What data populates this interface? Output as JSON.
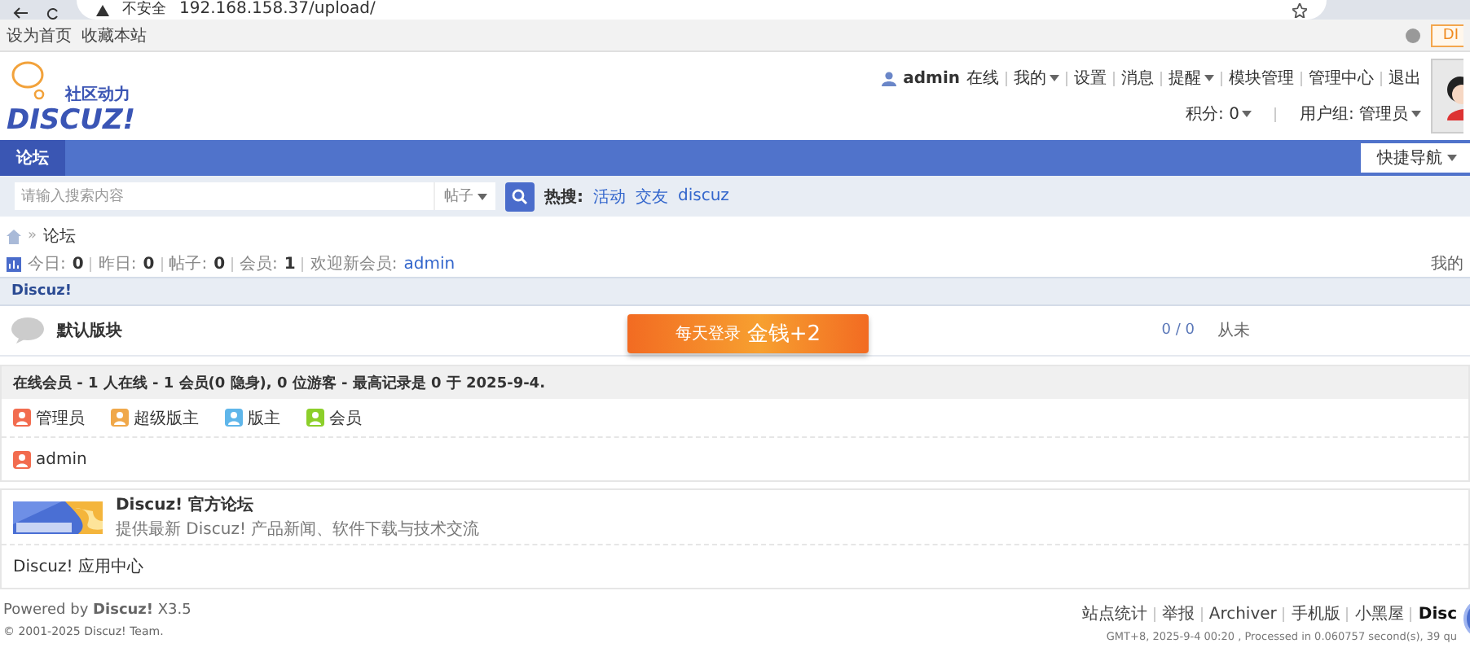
{
  "browser": {
    "security": "不安全",
    "url": "192.168.158.37/upload/"
  },
  "topbar": {
    "links": [
      "设为首页",
      "收藏本站"
    ],
    "diy": "DI"
  },
  "header": {
    "logo_tagline": "社区动力",
    "logo_text": "DISCUZ!",
    "user": "admin",
    "status": "在线",
    "links": [
      {
        "label": "我的",
        "dropdown": true
      },
      {
        "label": "设置",
        "dropdown": false
      },
      {
        "label": "消息",
        "dropdown": false
      },
      {
        "label": "提醒",
        "dropdown": true
      },
      {
        "label": "模块管理",
        "dropdown": false
      },
      {
        "label": "管理中心",
        "dropdown": false
      },
      {
        "label": "退出",
        "dropdown": false
      }
    ],
    "meta": [
      {
        "label": "积分: 0",
        "dropdown": true
      },
      {
        "label": "用户组: 管理员",
        "dropdown": true
      }
    ]
  },
  "nav": {
    "tabs": [
      {
        "label": "论坛",
        "selected": true
      }
    ],
    "quick": "快捷导航"
  },
  "search": {
    "placeholder": "请输入搜索内容",
    "type": "帖子",
    "hot_label": "热搜:",
    "hot": [
      "活动",
      "交友",
      "discuz"
    ]
  },
  "breadcrumb": {
    "separator": "»",
    "items": [
      "论坛"
    ]
  },
  "stats": [
    {
      "label": "今日:",
      "value": "0",
      "kind": "number"
    },
    {
      "label": "昨日:",
      "value": "0",
      "kind": "number"
    },
    {
      "label": "帖子:",
      "value": "0",
      "kind": "number"
    },
    {
      "label": "会员:",
      "value": "1",
      "kind": "number"
    },
    {
      "label": "欢迎新会员:",
      "value": "admin",
      "kind": "link"
    }
  ],
  "stats_right": "我的",
  "category": {
    "title": "Discuz!",
    "forums": [
      {
        "name": "默认版块",
        "counts": "0 / 0",
        "last": "从未"
      }
    ]
  },
  "promo": {
    "text": "每天登录",
    "bonus": "金钱+2"
  },
  "online": {
    "title": "在线会员 - 1 人在线 - 1 会员(0 隐身), 0 位游客 - 最高记录是 0 于 2025-9-4.",
    "legend": [
      {
        "label": "管理员",
        "color": "#f26c4f"
      },
      {
        "label": "超级版主",
        "color": "#f0a84a"
      },
      {
        "label": "版主",
        "color": "#5fb6ea"
      },
      {
        "label": "会员",
        "color": "#8ccf2a"
      }
    ],
    "users": [
      {
        "name": "admin",
        "color": "#f26c4f"
      }
    ]
  },
  "links": {
    "featured": {
      "title": "Discuz! 官方论坛",
      "description": "提供最新 Discuz! 产品新闻、软件下载与技术交流"
    },
    "text_links": [
      "Discuz! 应用中心"
    ]
  },
  "footer": {
    "powered": "Powered by **Discuz!** X3.5",
    "copyright": "© 2001-2025 Discuz! Team.",
    "links": [
      {
        "label": "站点统计",
        "bold": false
      },
      {
        "label": "举报",
        "bold": false
      },
      {
        "label": "Archiver",
        "bold": false
      },
      {
        "label": "手机版",
        "bold": false
      },
      {
        "label": "小黑屋",
        "bold": false
      },
      {
        "label": "Disc",
        "bold": true
      }
    ],
    "info": "GMT+8, 2025-9-4 00:20 , Processed in 0.060757 second(s), 39 qu"
  }
}
